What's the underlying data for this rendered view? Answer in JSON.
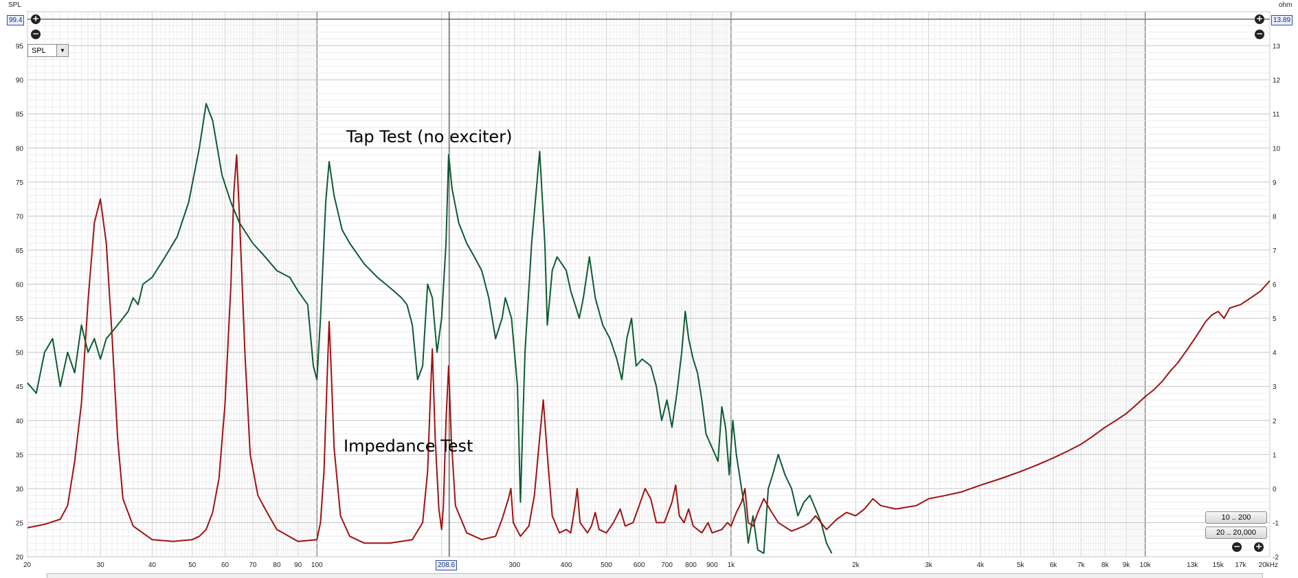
{
  "chart_data": {
    "type": "line",
    "x_scale": "log",
    "x_unit": "kHz",
    "xlim": [
      20,
      20000
    ],
    "left_axis": {
      "title": "SPL",
      "range": [
        20,
        100
      ],
      "top_value": "99.4"
    },
    "right_axis": {
      "title": "ohm",
      "range": [
        -2,
        14
      ],
      "top_value": "13.89"
    },
    "x_tick_labels": [
      {
        "v": 20,
        "t": "20"
      },
      {
        "v": 30,
        "t": "30"
      },
      {
        "v": 40,
        "t": "40"
      },
      {
        "v": 50,
        "t": "50"
      },
      {
        "v": 60,
        "t": "60"
      },
      {
        "v": 70,
        "t": "70"
      },
      {
        "v": 80,
        "t": "80"
      },
      {
        "v": 90,
        "t": "90"
      },
      {
        "v": 100,
        "t": "100"
      },
      {
        "v": 300,
        "t": "300"
      },
      {
        "v": 400,
        "t": "400"
      },
      {
        "v": 500,
        "t": "500"
      },
      {
        "v": 600,
        "t": "600"
      },
      {
        "v": 700,
        "t": "700"
      },
      {
        "v": 800,
        "t": "800"
      },
      {
        "v": 900,
        "t": "900"
      },
      {
        "v": 1000,
        "t": "1k"
      },
      {
        "v": 2000,
        "t": "2k"
      },
      {
        "v": 3000,
        "t": "3k"
      },
      {
        "v": 4000,
        "t": "4k"
      },
      {
        "v": 5000,
        "t": "5k"
      },
      {
        "v": 6000,
        "t": "6k"
      },
      {
        "v": 7000,
        "t": "7k"
      },
      {
        "v": 8000,
        "t": "8k"
      },
      {
        "v": 9000,
        "t": "9k"
      },
      {
        "v": 10000,
        "t": "10k"
      },
      {
        "v": 13000,
        "t": "13k",
        "faded": true
      },
      {
        "v": 15000,
        "t": "15k",
        "faded": true
      },
      {
        "v": 17000,
        "t": "17k",
        "faded": true
      },
      {
        "v": 20000,
        "t": "20kHz"
      }
    ],
    "left_tick_labels": [
      "95",
      "90",
      "85",
      "80",
      "75",
      "70",
      "65",
      "60",
      "55",
      "50",
      "45",
      "40",
      "35",
      "30",
      "25",
      "20"
    ],
    "right_tick_labels": [
      "13",
      "12",
      "11",
      "10",
      "9",
      "8",
      "7",
      "6",
      "5",
      "4",
      "3",
      "2",
      "1",
      "0",
      "-1",
      "-2"
    ],
    "cursor": {
      "x": 208.6,
      "label": "208.6"
    },
    "annotations": [
      "Tap Test (no exciter)",
      "Impedance Test"
    ],
    "series": [
      {
        "name": "Tap Test (no exciter)",
        "axis": "left",
        "color": "#0c5a32",
        "points": [
          [
            20,
            45.5
          ],
          [
            21,
            44
          ],
          [
            22,
            50
          ],
          [
            23,
            52
          ],
          [
            24,
            45
          ],
          [
            25,
            50
          ],
          [
            26,
            47
          ],
          [
            27,
            54
          ],
          [
            28,
            50
          ],
          [
            29,
            52
          ],
          [
            30,
            49
          ],
          [
            31,
            52
          ],
          [
            33,
            54
          ],
          [
            35,
            56
          ],
          [
            36,
            58
          ],
          [
            37,
            57
          ],
          [
            38,
            60
          ],
          [
            40,
            61
          ],
          [
            43,
            64
          ],
          [
            46,
            67
          ],
          [
            49,
            72
          ],
          [
            52,
            80
          ],
          [
            54,
            86.5
          ],
          [
            56,
            84
          ],
          [
            59,
            76
          ],
          [
            62,
            72
          ],
          [
            65,
            69
          ],
          [
            70,
            66
          ],
          [
            75,
            64
          ],
          [
            80,
            62
          ],
          [
            86,
            61
          ],
          [
            90,
            59
          ],
          [
            95,
            57
          ],
          [
            98,
            48
          ],
          [
            100,
            46
          ],
          [
            102,
            55
          ],
          [
            105,
            72
          ],
          [
            107,
            78
          ],
          [
            110,
            73
          ],
          [
            115,
            68
          ],
          [
            120,
            66
          ],
          [
            130,
            63
          ],
          [
            140,
            61
          ],
          [
            150,
            59.5
          ],
          [
            160,
            58
          ],
          [
            165,
            57
          ],
          [
            170,
            54
          ],
          [
            175,
            46
          ],
          [
            180,
            48
          ],
          [
            185,
            60
          ],
          [
            190,
            58
          ],
          [
            195,
            50
          ],
          [
            200,
            55
          ],
          [
            205,
            66
          ],
          [
            208,
            79
          ],
          [
            212,
            74
          ],
          [
            220,
            69
          ],
          [
            230,
            66
          ],
          [
            240,
            64
          ],
          [
            250,
            62
          ],
          [
            260,
            58
          ],
          [
            270,
            52
          ],
          [
            280,
            55
          ],
          [
            285,
            58
          ],
          [
            295,
            55
          ],
          [
            305,
            45
          ],
          [
            310,
            28
          ],
          [
            318,
            50
          ],
          [
            330,
            66
          ],
          [
            345,
            79.5
          ],
          [
            355,
            66
          ],
          [
            360,
            54
          ],
          [
            370,
            62
          ],
          [
            380,
            64
          ],
          [
            390,
            63
          ],
          [
            400,
            62
          ],
          [
            410,
            59
          ],
          [
            420,
            57
          ],
          [
            430,
            55
          ],
          [
            440,
            58
          ],
          [
            455,
            64
          ],
          [
            470,
            58
          ],
          [
            490,
            54
          ],
          [
            510,
            52
          ],
          [
            530,
            49
          ],
          [
            545,
            46
          ],
          [
            560,
            52
          ],
          [
            575,
            55
          ],
          [
            590,
            48
          ],
          [
            610,
            49
          ],
          [
            640,
            48
          ],
          [
            660,
            45
          ],
          [
            680,
            40
          ],
          [
            700,
            43
          ],
          [
            720,
            39
          ],
          [
            740,
            44
          ],
          [
            760,
            50
          ],
          [
            775,
            56
          ],
          [
            790,
            52
          ],
          [
            810,
            49
          ],
          [
            830,
            47
          ],
          [
            850,
            43
          ],
          [
            870,
            38
          ],
          [
            900,
            36
          ],
          [
            930,
            34
          ],
          [
            950,
            42
          ],
          [
            970,
            39
          ],
          [
            990,
            32
          ],
          [
            1010,
            40
          ],
          [
            1030,
            35
          ],
          [
            1060,
            30
          ],
          [
            1080,
            27
          ],
          [
            1100,
            22
          ],
          [
            1130,
            26
          ],
          [
            1160,
            21
          ],
          [
            1200,
            20.5
          ],
          [
            1230,
            30
          ],
          [
            1260,
            32
          ],
          [
            1300,
            35
          ],
          [
            1350,
            32
          ],
          [
            1400,
            30
          ],
          [
            1450,
            26
          ],
          [
            1500,
            28
          ],
          [
            1550,
            29
          ],
          [
            1600,
            27
          ],
          [
            1650,
            25
          ],
          [
            1700,
            22
          ],
          [
            1750,
            20.5
          ]
        ]
      },
      {
        "name": "Impedance Test",
        "axis": "right",
        "color": "#a01010",
        "points": [
          [
            20,
            -1.15
          ],
          [
            22,
            -1.05
          ],
          [
            24,
            -0.9
          ],
          [
            25,
            -0.5
          ],
          [
            26,
            0.8
          ],
          [
            27,
            2.5
          ],
          [
            28,
            5.5
          ],
          [
            29,
            7.8
          ],
          [
            30,
            8.5
          ],
          [
            31,
            7.2
          ],
          [
            32,
            4.5
          ],
          [
            33,
            1.5
          ],
          [
            34,
            -0.3
          ],
          [
            36,
            -1.1
          ],
          [
            40,
            -1.5
          ],
          [
            45,
            -1.55
          ],
          [
            50,
            -1.5
          ],
          [
            52,
            -1.4
          ],
          [
            54,
            -1.2
          ],
          [
            56,
            -0.7
          ],
          [
            58,
            0.3
          ],
          [
            60,
            2.5
          ],
          [
            62,
            6
          ],
          [
            63,
            8.7
          ],
          [
            64,
            9.8
          ],
          [
            65,
            8
          ],
          [
            67,
            4
          ],
          [
            69,
            1
          ],
          [
            72,
            -0.2
          ],
          [
            75,
            -0.6
          ],
          [
            80,
            -1.2
          ],
          [
            90,
            -1.55
          ],
          [
            100,
            -1.5
          ],
          [
            102,
            -1.0
          ],
          [
            104,
            0.5
          ],
          [
            106,
            3.5
          ],
          [
            107,
            4.9
          ],
          [
            108,
            3.8
          ],
          [
            110,
            1.2
          ],
          [
            114,
            -0.8
          ],
          [
            120,
            -1.4
          ],
          [
            130,
            -1.6
          ],
          [
            150,
            -1.6
          ],
          [
            170,
            -1.5
          ],
          [
            180,
            -1.0
          ],
          [
            185,
            0.5
          ],
          [
            188,
            2.8
          ],
          [
            190,
            4.1
          ],
          [
            193,
            1.5
          ],
          [
            197,
            -0.6
          ],
          [
            200,
            -1.2
          ],
          [
            202,
            -0.5
          ],
          [
            205,
            2
          ],
          [
            208,
            3.6
          ],
          [
            211,
            1.5
          ],
          [
            216,
            -0.5
          ],
          [
            230,
            -1.3
          ],
          [
            250,
            -1.5
          ],
          [
            270,
            -1.4
          ],
          [
            280,
            -0.9
          ],
          [
            290,
            -0.3
          ],
          [
            294,
            0
          ],
          [
            298,
            -1.0
          ],
          [
            310,
            -1.4
          ],
          [
            325,
            -1.1
          ],
          [
            335,
            -0.2
          ],
          [
            345,
            1.5
          ],
          [
            352,
            2.6
          ],
          [
            360,
            1.0
          ],
          [
            370,
            -0.8
          ],
          [
            385,
            -1.3
          ],
          [
            400,
            -1.2
          ],
          [
            410,
            -1.3
          ],
          [
            420,
            -0.5
          ],
          [
            425,
            0
          ],
          [
            432,
            -1.0
          ],
          [
            450,
            -1.3
          ],
          [
            460,
            -1.1
          ],
          [
            470,
            -0.7
          ],
          [
            480,
            -1.2
          ],
          [
            500,
            -1.3
          ],
          [
            520,
            -1.0
          ],
          [
            540,
            -0.6
          ],
          [
            555,
            -1.1
          ],
          [
            580,
            -1.0
          ],
          [
            600,
            -0.5
          ],
          [
            620,
            0
          ],
          [
            640,
            -0.3
          ],
          [
            660,
            -1.0
          ],
          [
            690,
            -1.0
          ],
          [
            720,
            -0.4
          ],
          [
            735,
            0.1
          ],
          [
            750,
            -0.8
          ],
          [
            770,
            -1.0
          ],
          [
            790,
            -0.6
          ],
          [
            810,
            -1.1
          ],
          [
            850,
            -1.3
          ],
          [
            880,
            -1.0
          ],
          [
            900,
            -1.3
          ],
          [
            950,
            -1.2
          ],
          [
            980,
            -1.0
          ],
          [
            1000,
            -1.1
          ],
          [
            1030,
            -0.7
          ],
          [
            1060,
            -0.4
          ],
          [
            1080,
            0
          ],
          [
            1100,
            -1.0
          ],
          [
            1130,
            -1.1
          ],
          [
            1160,
            -0.7
          ],
          [
            1200,
            -0.3
          ],
          [
            1240,
            -0.6
          ],
          [
            1300,
            -1.0
          ],
          [
            1400,
            -1.25
          ],
          [
            1500,
            -1.1
          ],
          [
            1550,
            -1.0
          ],
          [
            1600,
            -0.8
          ],
          [
            1700,
            -1.2
          ],
          [
            1800,
            -0.9
          ],
          [
            1900,
            -0.7
          ],
          [
            2000,
            -0.8
          ],
          [
            2100,
            -0.6
          ],
          [
            2200,
            -0.3
          ],
          [
            2300,
            -0.5
          ],
          [
            2500,
            -0.6
          ],
          [
            2800,
            -0.5
          ],
          [
            3000,
            -0.3
          ],
          [
            3300,
            -0.2
          ],
          [
            3600,
            -0.1
          ],
          [
            4000,
            0.1
          ],
          [
            4500,
            0.3
          ],
          [
            5000,
            0.5
          ],
          [
            5500,
            0.7
          ],
          [
            6000,
            0.9
          ],
          [
            6500,
            1.1
          ],
          [
            7000,
            1.3
          ],
          [
            7500,
            1.55
          ],
          [
            8000,
            1.8
          ],
          [
            8500,
            2.0
          ],
          [
            9000,
            2.2
          ],
          [
            9500,
            2.45
          ],
          [
            10000,
            2.7
          ],
          [
            10500,
            2.9
          ],
          [
            11000,
            3.15
          ],
          [
            11500,
            3.45
          ],
          [
            12000,
            3.7
          ],
          [
            12500,
            4.0
          ],
          [
            13000,
            4.3
          ],
          [
            13500,
            4.6
          ],
          [
            14000,
            4.9
          ],
          [
            14500,
            5.1
          ],
          [
            15000,
            5.2
          ],
          [
            15500,
            5.0
          ],
          [
            16000,
            5.3
          ],
          [
            17000,
            5.4
          ],
          [
            18000,
            5.6
          ],
          [
            19000,
            5.8
          ],
          [
            20000,
            6.1
          ]
        ]
      }
    ]
  },
  "controls": {
    "dropdown_value": "SPL",
    "range_button_1": "10 .. 200",
    "range_button_2": "20 .. 20,000",
    "zoom_in_symbol": "+",
    "zoom_out_symbol": "−"
  }
}
